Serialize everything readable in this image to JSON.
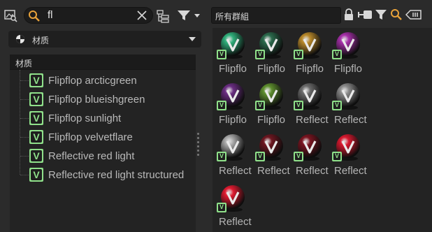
{
  "left_panel": {
    "search": {
      "value": "fl"
    },
    "dropdown": {
      "selected": "材质"
    },
    "tree": {
      "header": "材质",
      "items": [
        {
          "label": "Flipflop arcticgreen",
          "icon": "v-material-icon"
        },
        {
          "label": "Flipflop blueishgreen",
          "icon": "v-material-icon"
        },
        {
          "label": "Flipflop sunlight",
          "icon": "v-material-icon"
        },
        {
          "label": "Flipflop velvetflare",
          "icon": "v-material-icon"
        },
        {
          "label": "Reflective red light",
          "icon": "v-material-icon"
        },
        {
          "label": "Reflective red light structured",
          "icon": "v-material-icon"
        }
      ]
    }
  },
  "right_panel": {
    "group_field": {
      "value": "所有群組"
    },
    "toolbar_icons": [
      "lock-icon",
      "node-link-icon",
      "filter-icon",
      "search-icon",
      "tag-icon"
    ],
    "thumbnails": [
      {
        "label": "Flipflo",
        "color": "#2fae7a"
      },
      {
        "label": "Flipflo",
        "color": "#2b6a4c"
      },
      {
        "label": "Flipflo",
        "color": "#b9892a"
      },
      {
        "label": "Flipflo",
        "color": "#a52fa8"
      },
      {
        "label": "Flipflo",
        "color": "#6a2d82"
      },
      {
        "label": "Flipflo",
        "color": "#5e8e2e"
      },
      {
        "label": "Reflect",
        "color": "#6a6a6a"
      },
      {
        "label": "Reflect",
        "color": "#8a8a8a"
      },
      {
        "label": "Reflect",
        "color": "#a8a8a8"
      },
      {
        "label": "Reflect",
        "color": "#6e1620"
      },
      {
        "label": "Reflect",
        "color": "#7a1420"
      },
      {
        "label": "Reflect",
        "color": "#d8182e"
      },
      {
        "label": "Reflect",
        "color": "#e01a30"
      }
    ]
  },
  "colors": {
    "accent_orange": "#e8a23a",
    "badge_green": "#8fe08a"
  }
}
